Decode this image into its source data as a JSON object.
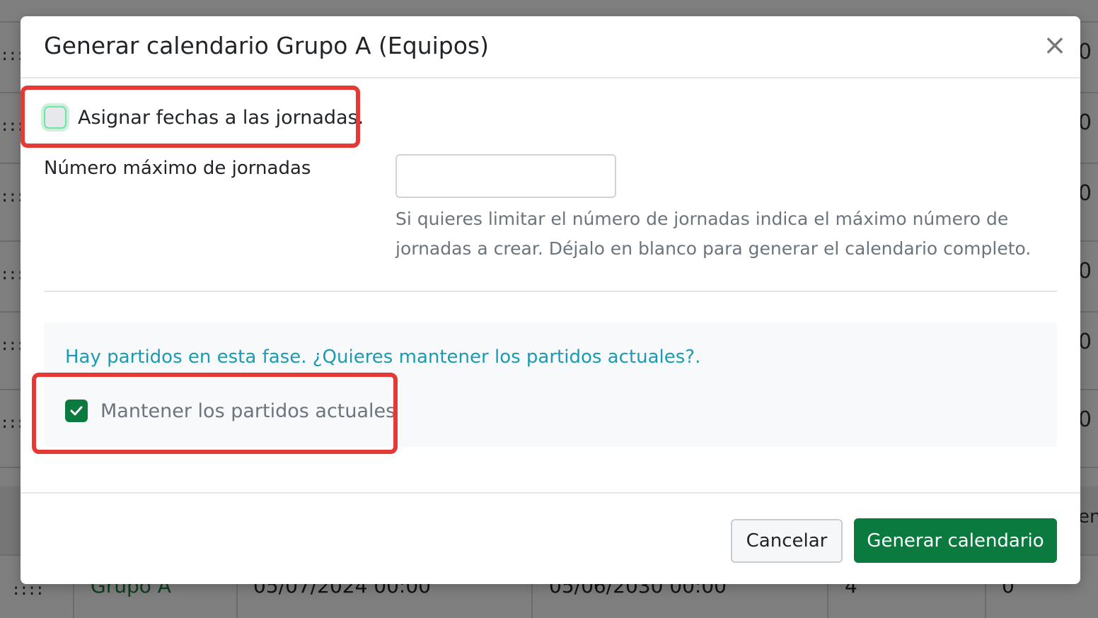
{
  "modal": {
    "title": "Generar calendario Grupo A (Equipos)",
    "close_glyph": "×",
    "assign_dates_label": "Asignar fechas a las jornadas.",
    "assign_dates_checked": false,
    "max_rounds": {
      "label": "Número máximo de jornadas",
      "value": "",
      "help": "Si quieres limitar el número de jornadas indica el máximo número de jornadas a crear. Déjalo en blanco para generar el calendario completo."
    },
    "existing_matches": {
      "notice": "Hay partidos en esta fase. ¿Quieres mantener los partidos actuales?.",
      "keep_label": "Mantener los partidos actuales",
      "keep_checked": true
    },
    "footer": {
      "cancel_label": "Cancelar",
      "generate_label": "Generar calendario"
    }
  },
  "background": {
    "row_handle": "::::",
    "right_values": [
      "0",
      "0",
      "0",
      "0",
      "0",
      "0"
    ],
    "header_fragment": "en",
    "bottom_row": {
      "group": "Grupo A",
      "start": "05/07/2024 00:00",
      "end": "05/06/2030 00:00",
      "count": "4",
      "last": "0"
    }
  },
  "colors": {
    "primary": "#0a7a3e",
    "info": "#1a9bb4",
    "highlight": "#e53935"
  }
}
